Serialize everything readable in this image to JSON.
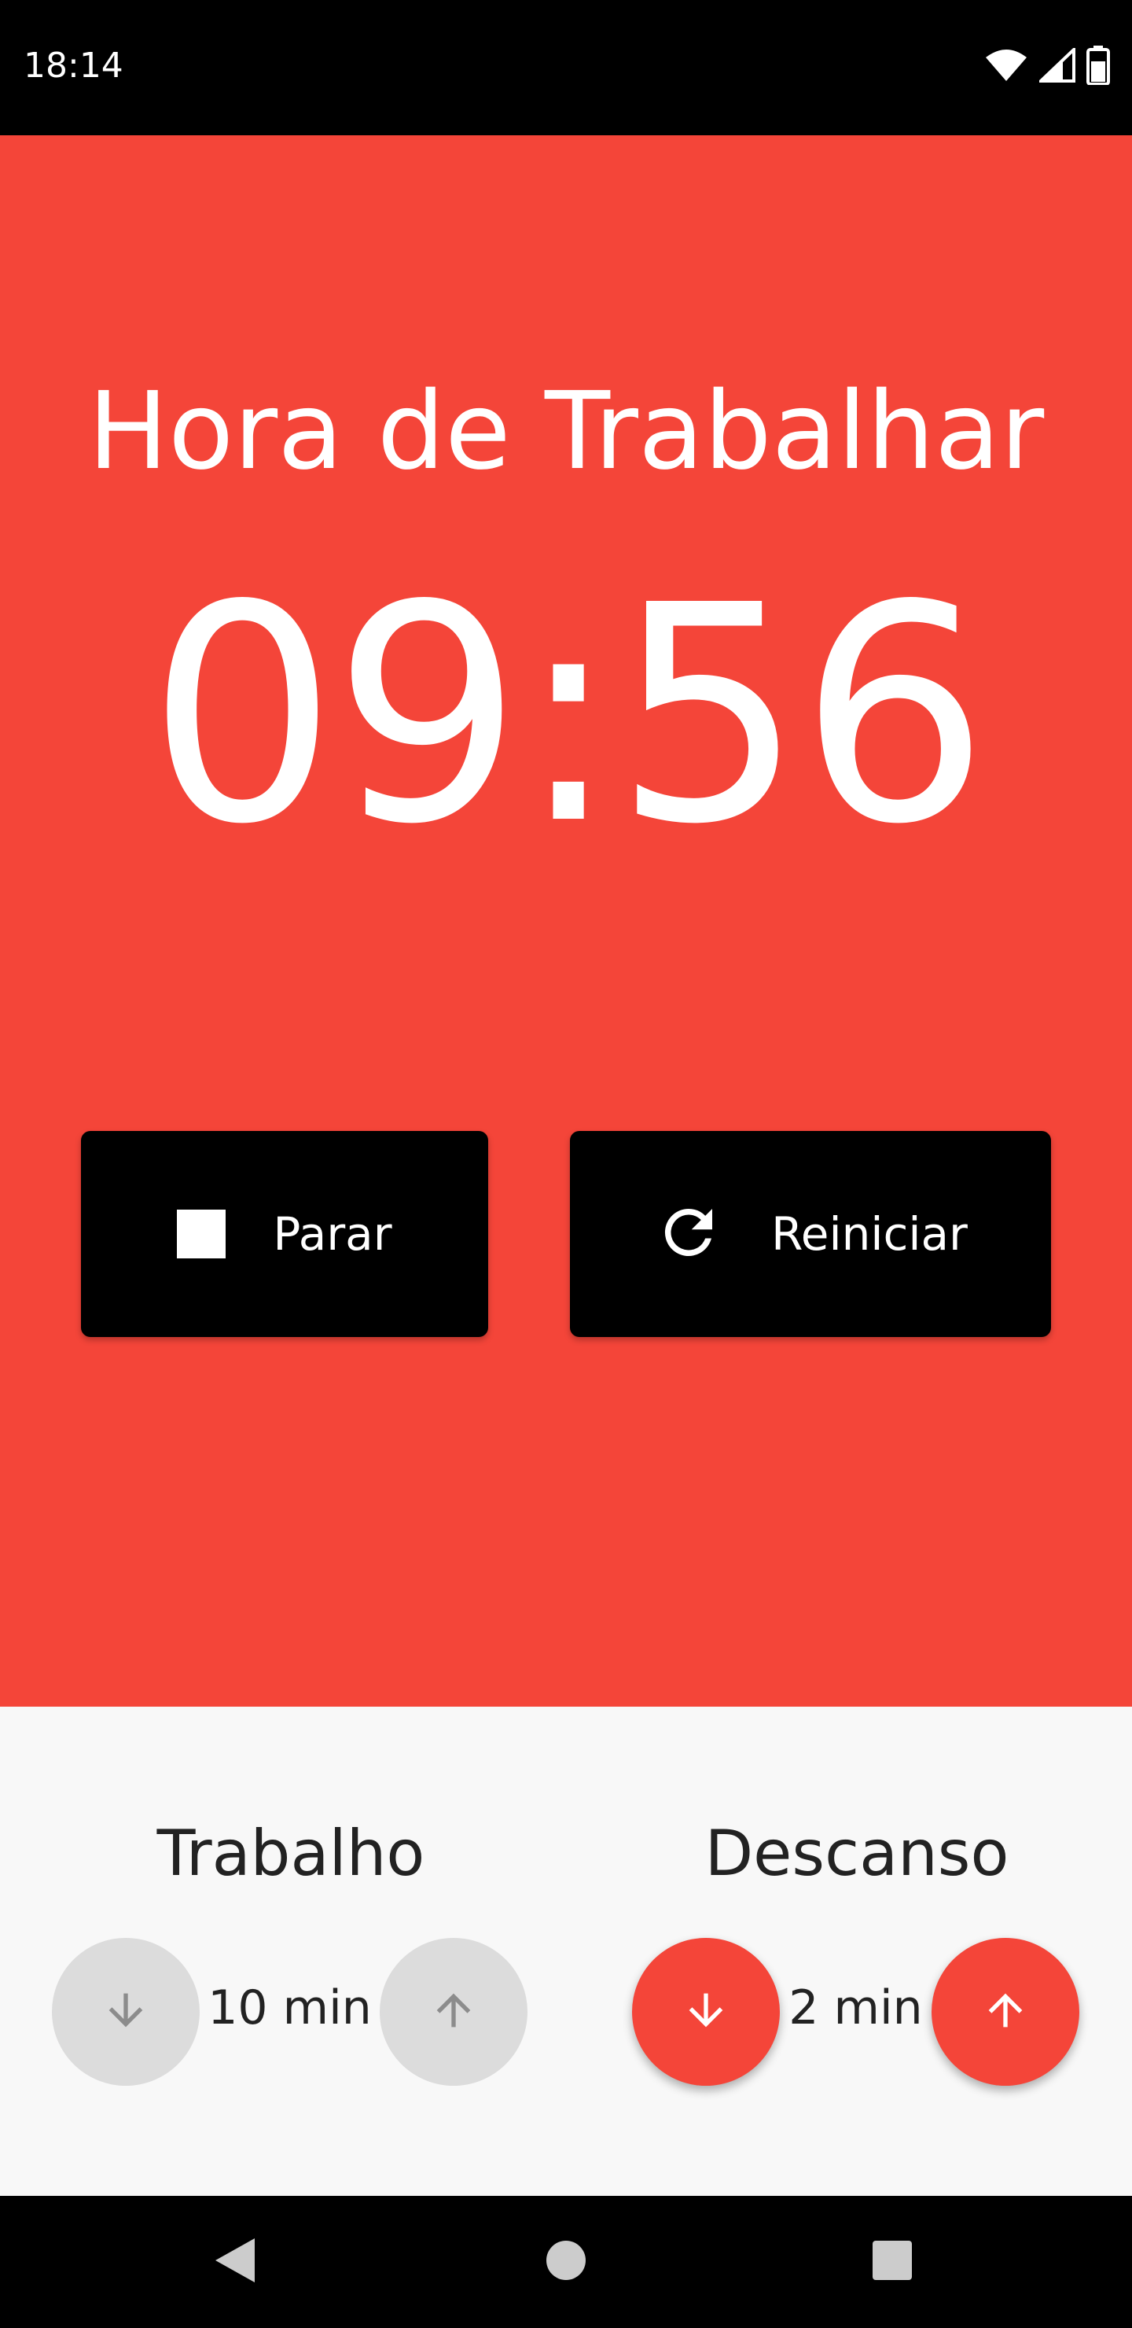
{
  "status_bar": {
    "time": "18:14",
    "icons": [
      "wifi-icon",
      "signal-icon",
      "battery-icon"
    ]
  },
  "timer_panel": {
    "mode_title": "Hora de Trabalhar",
    "time_remaining": "09:56",
    "background_color": "#f44539",
    "stop_button": {
      "label": "Parar",
      "icon": "stop-icon"
    },
    "restart_button": {
      "label": "Reiniciar",
      "icon": "refresh-icon"
    }
  },
  "settings": {
    "work": {
      "title": "Trabalho",
      "value": "10 min",
      "decrease_icon": "arrow-down-icon",
      "increase_icon": "arrow-up-icon",
      "enabled": false
    },
    "rest": {
      "title": "Descanso",
      "value": "2 min",
      "decrease_icon": "arrow-down-icon",
      "increase_icon": "arrow-up-icon",
      "enabled": true
    }
  },
  "nav_bar": {
    "items": [
      "back-icon",
      "home-icon",
      "recents-icon"
    ]
  }
}
